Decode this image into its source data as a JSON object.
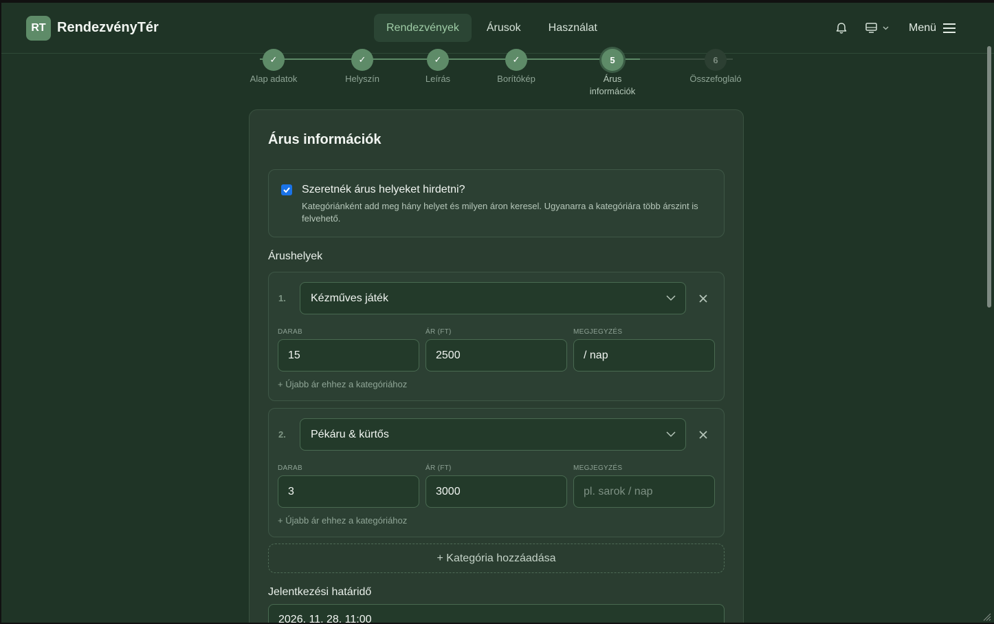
{
  "header": {
    "logo_initials": "RT",
    "logo_text": "RendezvényTér",
    "nav": [
      {
        "label": "Rendezvények",
        "active": true
      },
      {
        "label": "Árusok",
        "active": false
      },
      {
        "label": "Használat",
        "active": false
      }
    ],
    "menu_label": "Menü"
  },
  "stepper": {
    "steps": [
      {
        "marker": "✓",
        "label": "Alap adatok",
        "state": "done"
      },
      {
        "marker": "✓",
        "label": "Helyszín",
        "state": "done"
      },
      {
        "marker": "✓",
        "label": "Leírás",
        "state": "done"
      },
      {
        "marker": "✓",
        "label": "Borítókép",
        "state": "done"
      },
      {
        "marker": "5",
        "label_line1": "Árus",
        "label_line2": "információk",
        "state": "current"
      },
      {
        "marker": "6",
        "label": "Összefoglaló",
        "state": "future"
      }
    ]
  },
  "card": {
    "title": "Árus információk",
    "option": {
      "checked": true,
      "title": "Szeretnék árus helyeket hirdetni?",
      "description": "Kategóriánként add meg hány helyet és milyen áron keresel. Ugyanarra a kategóriára több árszint is felvehető."
    },
    "stalls_label": "Árushelyek",
    "field_labels": {
      "count": "DARAB",
      "price": "ÁR (FT)",
      "note": "MEGJEGYZÉS"
    },
    "categories": [
      {
        "num": "1.",
        "category": "Kézműves játék",
        "count": "15",
        "price": "2500",
        "note": "/ nap",
        "note_placeholder": ""
      },
      {
        "num": "2.",
        "category": "Pékáru & kürtős",
        "count": "3",
        "price": "3000",
        "note": "",
        "note_placeholder": "pl. sarok / nap"
      }
    ],
    "add_price_label": "+ Újabb ár ehhez a kategóriához",
    "add_category_label": "+ Kategória hozzáadása",
    "deadline_label": "Jelentkezési határidő",
    "deadline_value": "2026. 11. 28. 11:00"
  }
}
